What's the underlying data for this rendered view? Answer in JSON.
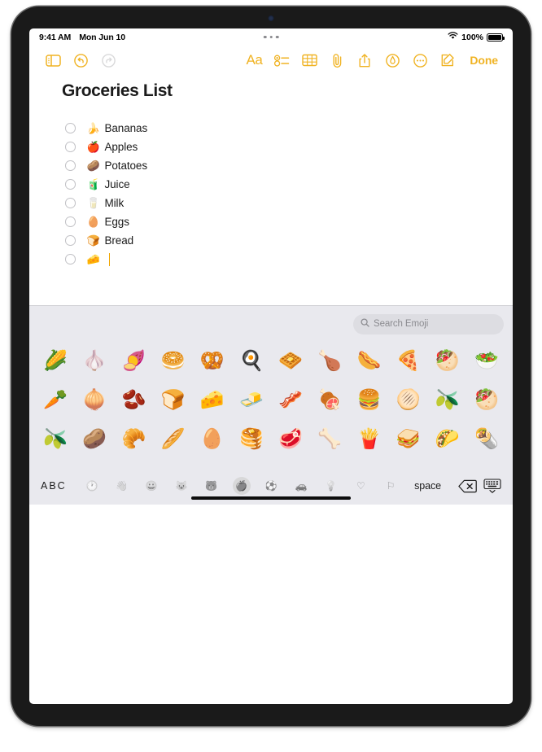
{
  "status_bar": {
    "time": "9:41 AM",
    "date": "Mon Jun 10",
    "wifi_icon": "wifi-icon",
    "battery_percent": "100%",
    "battery_icon": "battery-full-icon",
    "multitask_indicator": "three-dots-icon"
  },
  "toolbar": {
    "sidebar_icon": "sidebar-toggle-icon",
    "undo_icon": "undo-icon",
    "redo_icon": "redo-icon",
    "format_label": "Aa",
    "format_icon": "text-format-icon",
    "checklist_icon": "checklist-icon",
    "table_icon": "table-icon",
    "attachment_icon": "paperclip-icon",
    "share_icon": "share-icon",
    "markup_icon": "markup-pen-icon",
    "more_icon": "more-ellipsis-icon",
    "compose_icon": "compose-icon",
    "done_label": "Done",
    "accent_color": "#F0B323"
  },
  "note": {
    "title": "Groceries List",
    "checklist": [
      {
        "emoji": "🍌",
        "emoji_name": "banana-emoji",
        "text": "Bananas",
        "checked": false
      },
      {
        "emoji": "🍎",
        "emoji_name": "apple-emoji",
        "text": "Apples",
        "checked": false
      },
      {
        "emoji": "🥔",
        "emoji_name": "potato-emoji",
        "text": "Potatoes",
        "checked": false
      },
      {
        "emoji": "🧃",
        "emoji_name": "juice-box-emoji",
        "text": "Juice",
        "checked": false
      },
      {
        "emoji": "🥛",
        "emoji_name": "milk-glass-emoji",
        "text": "Milk",
        "checked": false
      },
      {
        "emoji": "🥚",
        "emoji_name": "egg-emoji",
        "text": "Eggs",
        "checked": false
      },
      {
        "emoji": "🍞",
        "emoji_name": "bread-emoji",
        "text": "Bread",
        "checked": false
      },
      {
        "emoji": "🧀",
        "emoji_name": "cheese-emoji",
        "text": "",
        "checked": false,
        "has_cursor": true
      }
    ]
  },
  "keyboard": {
    "search": {
      "placeholder": "Search Emoji",
      "icon": "search-icon"
    },
    "emoji_rows": [
      [
        {
          "char": "🌽",
          "name": "corn-emoji"
        },
        {
          "char": "🧄",
          "name": "garlic-emoji"
        },
        {
          "char": "🍠",
          "name": "roasted-sweet-potato-emoji"
        },
        {
          "char": "🥯",
          "name": "bagel-emoji"
        },
        {
          "char": "🥨",
          "name": "pretzel-emoji"
        },
        {
          "char": "🍳",
          "name": "cooking-fried-egg-emoji"
        },
        {
          "char": "🧇",
          "name": "waffle-emoji"
        },
        {
          "char": "🍗",
          "name": "poultry-leg-emoji"
        },
        {
          "char": "🌭",
          "name": "hot-dog-emoji"
        },
        {
          "char": "🍕",
          "name": "pizza-emoji"
        },
        {
          "char": "🥙",
          "name": "stuffed-flatbread-emoji"
        },
        {
          "char": "🥗",
          "name": "green-salad-emoji"
        }
      ],
      [
        {
          "char": "🥕",
          "name": "carrot-emoji"
        },
        {
          "char": "🧅",
          "name": "onion-emoji"
        },
        {
          "char": "🫘",
          "name": "ginger-root-emoji"
        },
        {
          "char": "🍞",
          "name": "bread-loaf-emoji"
        },
        {
          "char": "🧀",
          "name": "cheese-wedge-emoji"
        },
        {
          "char": "🧈",
          "name": "butter-emoji"
        },
        {
          "char": "🥓",
          "name": "bacon-emoji"
        },
        {
          "char": "🍖",
          "name": "meat-on-bone-emoji"
        },
        {
          "char": "🍔",
          "name": "hamburger-emoji"
        },
        {
          "char": "🫓",
          "name": "flatbread-emoji"
        },
        {
          "char": "🫒",
          "name": "falafel-emoji"
        },
        {
          "char": "🥙",
          "name": "stuffed-pita-emoji"
        }
      ],
      [
        {
          "char": "🫒",
          "name": "olive-emoji"
        },
        {
          "char": "🥔",
          "name": "potato-emoji"
        },
        {
          "char": "🥐",
          "name": "croissant-emoji"
        },
        {
          "char": "🥖",
          "name": "baguette-bread-emoji"
        },
        {
          "char": "🥚",
          "name": "egg-emoji"
        },
        {
          "char": "🥞",
          "name": "pancakes-emoji"
        },
        {
          "char": "🥩",
          "name": "cut-of-meat-emoji"
        },
        {
          "char": "🦴",
          "name": "bone-emoji"
        },
        {
          "char": "🍟",
          "name": "french-fries-emoji"
        },
        {
          "char": "🥪",
          "name": "sandwich-emoji"
        },
        {
          "char": "🌮",
          "name": "taco-emoji"
        },
        {
          "char": "🌯",
          "name": "burrito-emoji"
        }
      ]
    ],
    "bottom_bar": {
      "abc_label": "ABC",
      "space_label": "space",
      "delete_icon": "delete-backspace-icon",
      "hide_keyboard_icon": "hide-keyboard-icon",
      "categories": [
        {
          "char": "🕐",
          "name": "category-recent-icon",
          "active": false
        },
        {
          "char": "👋",
          "name": "category-people-icon",
          "active": false
        },
        {
          "char": "😀",
          "name": "category-smileys-icon",
          "active": false
        },
        {
          "char": "😺",
          "name": "category-animals-icon",
          "active": false
        },
        {
          "char": "🐻",
          "name": "category-nature-icon",
          "active": false
        },
        {
          "char": "🍎",
          "name": "category-food-icon",
          "active": true
        },
        {
          "char": "⚽",
          "name": "category-activity-icon",
          "active": false
        },
        {
          "char": "🚗",
          "name": "category-travel-icon",
          "active": false
        },
        {
          "char": "💡",
          "name": "category-objects-icon",
          "active": false
        },
        {
          "char": "♡",
          "name": "category-symbols-icon",
          "active": false
        },
        {
          "char": "⚐",
          "name": "category-flags-icon",
          "active": false
        }
      ]
    }
  },
  "home_indicator": "home-indicator"
}
